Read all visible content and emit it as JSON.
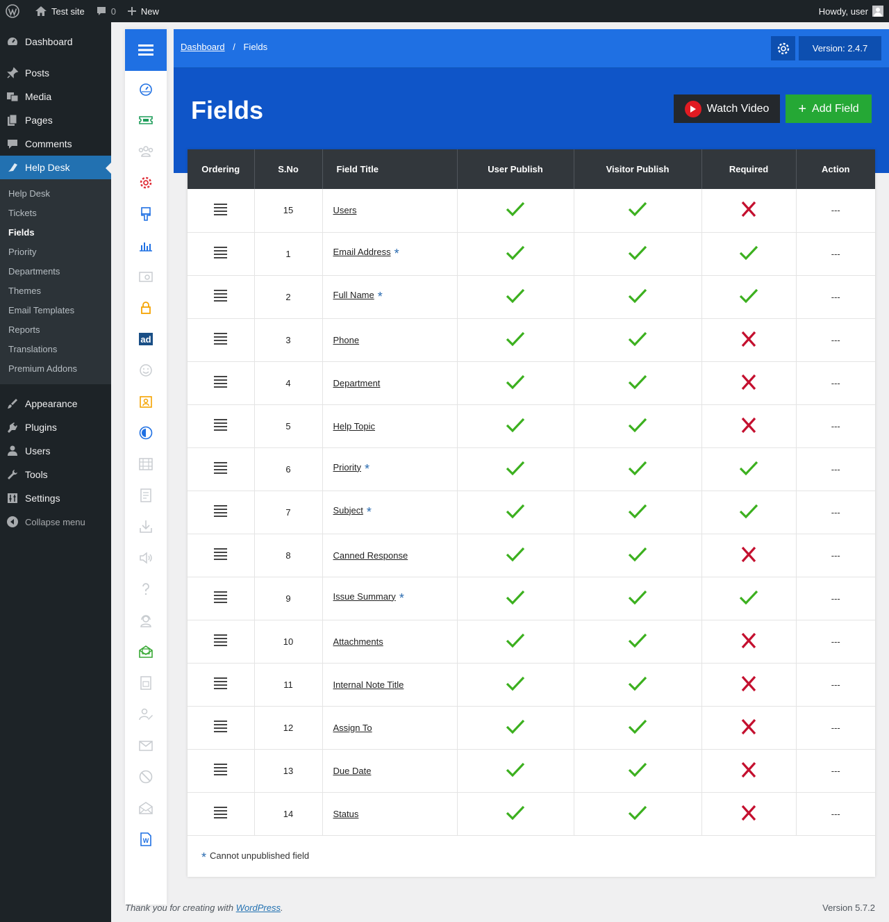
{
  "admin_bar": {
    "site_name": "Test site",
    "comments_count": "0",
    "new_label": "New",
    "greeting": "Howdy, user"
  },
  "admin_menu": {
    "top_items": [
      {
        "label": "Dashboard",
        "icon": "dashboard-icon"
      },
      {
        "label": "Posts",
        "icon": "pin-icon"
      },
      {
        "label": "Media",
        "icon": "media-icon"
      },
      {
        "label": "Pages",
        "icon": "pages-icon"
      },
      {
        "label": "Comments",
        "icon": "comment-icon"
      },
      {
        "label": "Help Desk",
        "icon": "helpdesk-icon"
      }
    ],
    "submenu": [
      "Help Desk",
      "Tickets",
      "Fields",
      "Priority",
      "Departments",
      "Themes",
      "Email Templates",
      "Reports",
      "Translations",
      "Premium Addons"
    ],
    "active_submenu": "Fields",
    "bottom_items": [
      {
        "label": "Appearance",
        "icon": "brush-icon"
      },
      {
        "label": "Plugins",
        "icon": "plugin-icon"
      },
      {
        "label": "Users",
        "icon": "user-icon"
      },
      {
        "label": "Tools",
        "icon": "wrench-icon"
      },
      {
        "label": "Settings",
        "icon": "settings-icon"
      }
    ],
    "collapse_label": "Collapse menu"
  },
  "icon_bar": {
    "icons": [
      "dashboard-gauge-icon",
      "ticket-icon",
      "users-group-icon",
      "gear-icon",
      "brush-icon",
      "bar-chart-icon",
      "email-stack-icon",
      "lock-icon",
      "ad-icon",
      "smiley-icon",
      "id-badge-icon",
      "theme-circle-icon",
      "ruler-icon",
      "document-icon",
      "download-icon",
      "speaker-icon",
      "help-icon",
      "support-agent-icon",
      "mail-open-icon",
      "invoice-icon",
      "user-edit-icon",
      "envelope-icon",
      "ban-icon",
      "mail-open-outline-icon",
      "word-doc-icon"
    ],
    "colors": {
      "accent": "#1f70e3",
      "muted": "#c8ccd0"
    }
  },
  "header": {
    "breadcrumb_home": "Dashboard",
    "breadcrumb_sep": "/",
    "breadcrumb_current": "Fields",
    "version": "Version: 2.4.7"
  },
  "hero": {
    "title": "Fields",
    "watch_video": "Watch Video",
    "add_field": "Add Field"
  },
  "table": {
    "columns": [
      "Ordering",
      "S.No",
      "Field Title",
      "User Publish",
      "Visitor Publish",
      "Required",
      "Action"
    ],
    "rows": [
      {
        "sno": "15",
        "title": "Users",
        "star": false,
        "user_publish": true,
        "visitor_publish": true,
        "required": false,
        "action": "---"
      },
      {
        "sno": "1",
        "title": "Email Address",
        "star": true,
        "user_publish": true,
        "visitor_publish": true,
        "required": true,
        "action": "---"
      },
      {
        "sno": "2",
        "title": "Full Name",
        "star": true,
        "user_publish": true,
        "visitor_publish": true,
        "required": true,
        "action": "---"
      },
      {
        "sno": "3",
        "title": "Phone",
        "star": false,
        "user_publish": true,
        "visitor_publish": true,
        "required": false,
        "action": "---"
      },
      {
        "sno": "4",
        "title": "Department",
        "star": false,
        "user_publish": true,
        "visitor_publish": true,
        "required": false,
        "action": "---"
      },
      {
        "sno": "5",
        "title": "Help Topic",
        "star": false,
        "user_publish": true,
        "visitor_publish": true,
        "required": false,
        "action": "---"
      },
      {
        "sno": "6",
        "title": "Priority",
        "star": true,
        "user_publish": true,
        "visitor_publish": true,
        "required": true,
        "action": "---"
      },
      {
        "sno": "7",
        "title": "Subject",
        "star": true,
        "user_publish": true,
        "visitor_publish": true,
        "required": true,
        "action": "---"
      },
      {
        "sno": "8",
        "title": "Canned Response",
        "star": false,
        "user_publish": true,
        "visitor_publish": true,
        "required": false,
        "action": "---"
      },
      {
        "sno": "9",
        "title": "Issue Summary",
        "star": true,
        "user_publish": true,
        "visitor_publish": true,
        "required": true,
        "action": "---"
      },
      {
        "sno": "10",
        "title": "Attachments",
        "star": false,
        "user_publish": true,
        "visitor_publish": true,
        "required": false,
        "action": "---"
      },
      {
        "sno": "11",
        "title": "Internal Note Title",
        "star": false,
        "user_publish": true,
        "visitor_publish": true,
        "required": false,
        "action": "---"
      },
      {
        "sno": "12",
        "title": "Assign To",
        "star": false,
        "user_publish": true,
        "visitor_publish": true,
        "required": false,
        "action": "---"
      },
      {
        "sno": "13",
        "title": "Due Date",
        "star": false,
        "user_publish": true,
        "visitor_publish": true,
        "required": false,
        "action": "---"
      },
      {
        "sno": "14",
        "title": "Status",
        "star": false,
        "user_publish": true,
        "visitor_publish": true,
        "required": false,
        "action": "---"
      }
    ],
    "star_glyph": "*",
    "note": "Cannot unpublished field",
    "colors": {
      "check": "#3cb01f",
      "cross": "#c4102f",
      "header_bg": "#32373c"
    }
  },
  "footer": {
    "thanks_prefix": "Thank you for creating with ",
    "thanks_link": "WordPress",
    "thanks_suffix": ".",
    "wp_version": "Version 5.7.2"
  }
}
